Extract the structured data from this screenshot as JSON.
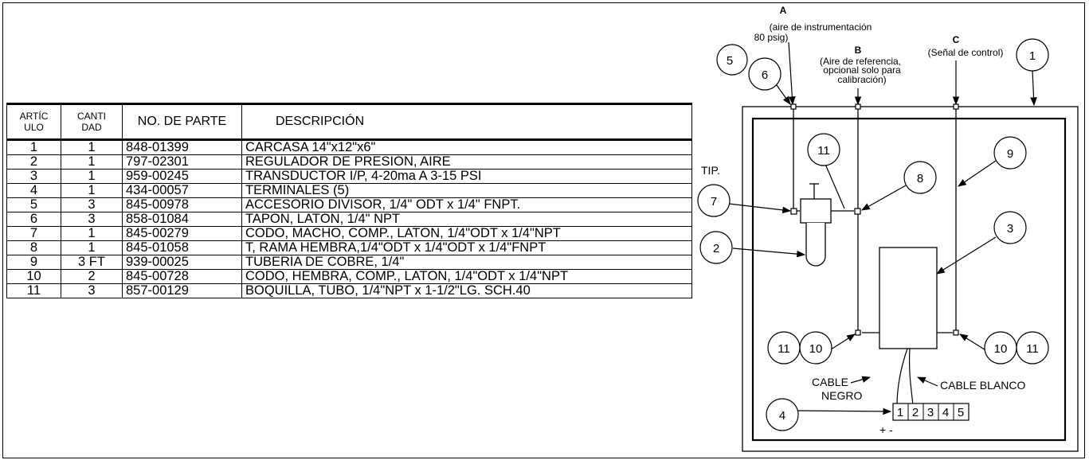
{
  "table": {
    "headers": {
      "item": "ARTÍC ULO",
      "item_l1": "ARTÍC",
      "item_l2": "ULO",
      "qty": "CANTI DAD",
      "qty_l1": "CANTI",
      "qty_l2": "DAD",
      "part": "NO. DE PARTE",
      "desc": "DESCRIPCIÓN"
    },
    "rows": [
      {
        "item": "1",
        "qty": "1",
        "part": "848-01399",
        "desc": "CARCASA 14\"x12\"x6\""
      },
      {
        "item": "2",
        "qty": "1",
        "part": "797-02301",
        "desc": "REGULADOR DE PRESIÓN, AIRE"
      },
      {
        "item": "3",
        "qty": "1",
        "part": "959-00245",
        "desc": "TRANSDUCTOR I/P, 4-20ma A 3-15 PSI"
      },
      {
        "item": "4",
        "qty": "1",
        "part": "434-00057",
        "desc": "TERMINALES (5)"
      },
      {
        "item": "5",
        "qty": "3",
        "part": "845-00978",
        "desc": "ACCESORIO DIVISOR, 1/4\" ODT x 1/4\" FNPT."
      },
      {
        "item": "6",
        "qty": "3",
        "part": "858-01084",
        "desc": "TAPÓN, LATÓN, 1/4\" NPT"
      },
      {
        "item": "7",
        "qty": "1",
        "part": "845-00279",
        "desc": "CODO, MACHO, COMP., LATÓN, 1/4\"ODT x 1/4\"NPT"
      },
      {
        "item": "8",
        "qty": "1",
        "part": "845-01058",
        "desc": "T, RAMA HEMBRA,1/4\"ODT x 1/4\"ODT x 1/4\"FNPT"
      },
      {
        "item": "9",
        "qty": "3 FT",
        "part": "939-00025",
        "desc": "TUBERÍA DE COBRE, 1/4\""
      },
      {
        "item": "10",
        "qty": "2",
        "part": "845-00728",
        "desc": "CODO, HEMBRA, COMP., LATÓN, 1/4\"ODT x 1/4\"NPT"
      },
      {
        "item": "11",
        "qty": "3",
        "part": "857-00129",
        "desc": "BOQUILLA, TUBO, 1/4\"NPT x 1-1/2\"LG. SCH.40"
      }
    ]
  },
  "diagram": {
    "port_a": {
      "letter": "A",
      "line1": "(aire de instrumentación",
      "line2": "80 psig)"
    },
    "port_b": {
      "letter": "B",
      "line1": "(Aire de referencia,",
      "line2": "opcional solo para",
      "line3": "calibración)"
    },
    "port_c": {
      "letter": "C",
      "line1": "(Señal de control)"
    },
    "tip": "TIP.",
    "cable_negro_1": "CABLE",
    "cable_negro_2": "NEGRO",
    "cable_blanco": "CABLE BLANCO",
    "terminals": [
      "1",
      "2",
      "3",
      "4",
      "5"
    ],
    "polarity": "+ -",
    "callouts": {
      "c1": "1",
      "c2": "2",
      "c3": "3",
      "c4": "4",
      "c5": "5",
      "c6": "6",
      "c7": "7",
      "c8": "8",
      "c9": "9",
      "c10a": "10",
      "c10b": "10",
      "c11a": "11",
      "c11b": "11",
      "c11c": "11"
    }
  }
}
